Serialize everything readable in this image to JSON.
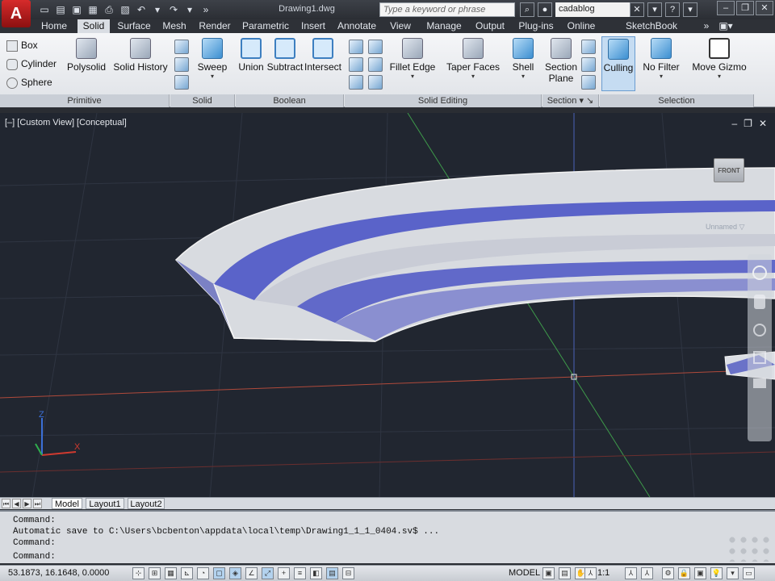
{
  "titlebar": {
    "logo": "A",
    "document_title": "Drawing1.dwg",
    "search_placeholder": "Type a keyword or phrase",
    "user_name": "cadablog"
  },
  "ribbon_tabs": [
    "Home",
    "Solid",
    "Surface",
    "Mesh",
    "Render",
    "Parametric",
    "Insert",
    "Annotate",
    "View",
    "Manage",
    "Output",
    "Plug-ins",
    "Online",
    "SketchBook Designer"
  ],
  "active_tab": "Solid",
  "ribbon": {
    "primitive": {
      "items": [
        "Box",
        "Cylinder",
        "Sphere"
      ],
      "footer": "Primitive"
    },
    "polysolid": "Polysolid",
    "solid_history": "Solid History",
    "solid": {
      "sweep": "Sweep",
      "footer": "Solid"
    },
    "boolean": {
      "union": "Union",
      "subtract": "Subtract",
      "intersect": "Intersect",
      "footer": "Boolean"
    },
    "solid_editing": {
      "fillet_edge": "Fillet Edge",
      "taper_faces": "Taper Faces",
      "shell": "Shell",
      "footer": "Solid Editing"
    },
    "section": {
      "section_plane_1": "Section",
      "section_plane_2": "Plane",
      "footer": "Section"
    },
    "selection": {
      "culling": "Culling",
      "no_filter": "No Filter",
      "move_gizmo": "Move Gizmo",
      "footer": "Selection"
    }
  },
  "viewport": {
    "label": "[–] [Custom View] [Conceptual]",
    "view_cube_face": "FRONT",
    "ucs_name": "Unnamed",
    "ucs_axes": {
      "z": "Z",
      "x": "X"
    }
  },
  "layout_tabs": [
    "Model",
    "Layout1",
    "Layout2"
  ],
  "active_layout": "Model",
  "command": {
    "history": [
      "Command:",
      "Automatic save to C:\\Users\\bcbenton\\appdata\\local\\temp\\Drawing1_1_1_0404.sv$ ...",
      "Command:"
    ],
    "prompt": "Command:"
  },
  "statusbar": {
    "coordinates": "53.1873, 16.1648, 0.0000",
    "space": "MODEL",
    "scale": "1:1"
  },
  "colors": {
    "accent_blue": "#3d7fc0",
    "axis_red": "#c0392b",
    "axis_green": "#2bb24c",
    "steps_blue": "#5a63c9"
  }
}
